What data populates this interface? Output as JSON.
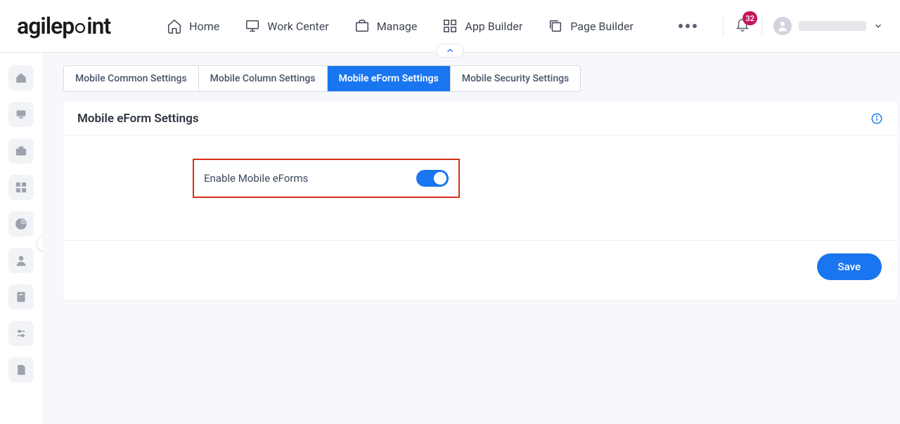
{
  "logo": {
    "text": "agilepoint"
  },
  "topnav": {
    "items": [
      {
        "label": "Home"
      },
      {
        "label": "Work Center"
      },
      {
        "label": "Manage"
      },
      {
        "label": "App Builder"
      },
      {
        "label": "Page Builder"
      }
    ],
    "notification_count": "32"
  },
  "tabs": [
    {
      "label": "Mobile Common Settings",
      "active": false
    },
    {
      "label": "Mobile Column Settings",
      "active": false
    },
    {
      "label": "Mobile eForm Settings",
      "active": true
    },
    {
      "label": "Mobile Security Settings",
      "active": false
    }
  ],
  "panel": {
    "title": "Mobile eForm Settings",
    "toggle_label": "Enable Mobile eForms",
    "toggle_on": true,
    "save_label": "Save"
  }
}
